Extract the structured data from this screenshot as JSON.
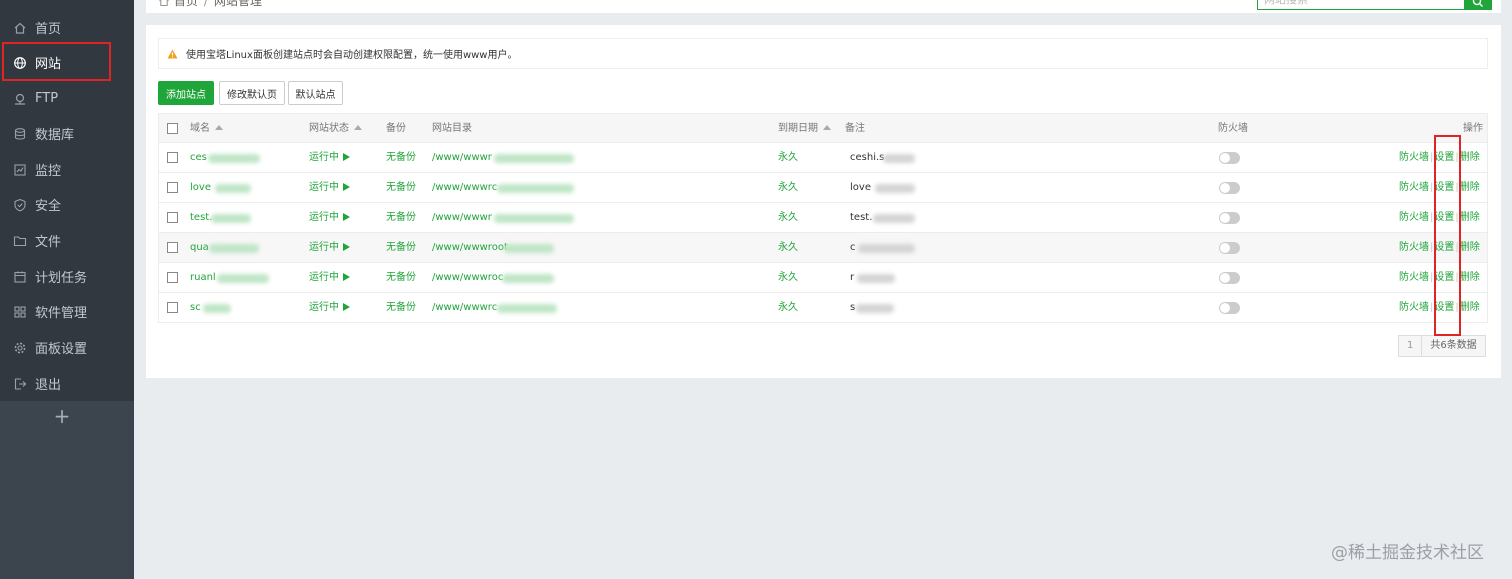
{
  "sidebar": {
    "items": [
      {
        "label": "首页",
        "icon": "home-icon"
      },
      {
        "label": "网站",
        "icon": "globe-icon",
        "active": true
      },
      {
        "label": "FTP",
        "icon": "ftp-icon"
      },
      {
        "label": "数据库",
        "icon": "database-icon"
      },
      {
        "label": "监控",
        "icon": "monitor-icon"
      },
      {
        "label": "安全",
        "icon": "shield-icon"
      },
      {
        "label": "文件",
        "icon": "folder-icon"
      },
      {
        "label": "计划任务",
        "icon": "calendar-icon"
      },
      {
        "label": "软件管理",
        "icon": "apps-icon"
      },
      {
        "label": "面板设置",
        "icon": "gear-icon"
      },
      {
        "label": "退出",
        "icon": "logout-icon"
      }
    ],
    "add_label": "+"
  },
  "breadcrumb": {
    "home": "首页",
    "separator": "/",
    "current": "网站管理"
  },
  "search": {
    "placeholder": "网站搜索"
  },
  "notice": {
    "text": "使用宝塔Linux面板创建站点时会自动创建权限配置，统一使用www用户。"
  },
  "toolbar": {
    "add_site": "添加站点",
    "edit_default_page": "修改默认页",
    "default_site": "默认站点"
  },
  "table": {
    "headers": {
      "domain": "域名",
      "status": "网站状态",
      "backup": "备份",
      "root": "网站目录",
      "expire": "到期日期",
      "note": "备注",
      "firewall": "防火墙",
      "actions": "操作"
    },
    "rows": [
      {
        "domain": "ces",
        "status": "运行中",
        "backup": "无备份",
        "root": "/www/wwwr",
        "expire": "永久",
        "note": "ceshi.s"
      },
      {
        "domain": "love",
        "status": "运行中",
        "backup": "无备份",
        "root": "/www/wwwrc",
        "expire": "永久",
        "note": "love"
      },
      {
        "domain": "test.",
        "status": "运行中",
        "backup": "无备份",
        "root": "/www/wwwr",
        "expire": "永久",
        "note": "test."
      },
      {
        "domain": "qua",
        "status": "运行中",
        "backup": "无备份",
        "root": "/www/wwwroot",
        "expire": "永久",
        "note": "c"
      },
      {
        "domain": "ruanl",
        "status": "运行中",
        "backup": "无备份",
        "root": "/www/wwwroc",
        "expire": "永久",
        "note": "r"
      },
      {
        "domain": "sc",
        "status": "运行中",
        "backup": "无备份",
        "root": "/www/wwwrc",
        "expire": "永久",
        "note": "s"
      }
    ],
    "actions": {
      "firewall": "防火墙",
      "separator": "|",
      "settings": "设置",
      "delete": "删除"
    }
  },
  "pagination": {
    "current": "1",
    "total": "共6条数据"
  },
  "watermark": "@稀土掘金技术社区",
  "colors": {
    "accent": "#20a53a",
    "sidebar": "#323840",
    "highlight": "#e02424"
  }
}
